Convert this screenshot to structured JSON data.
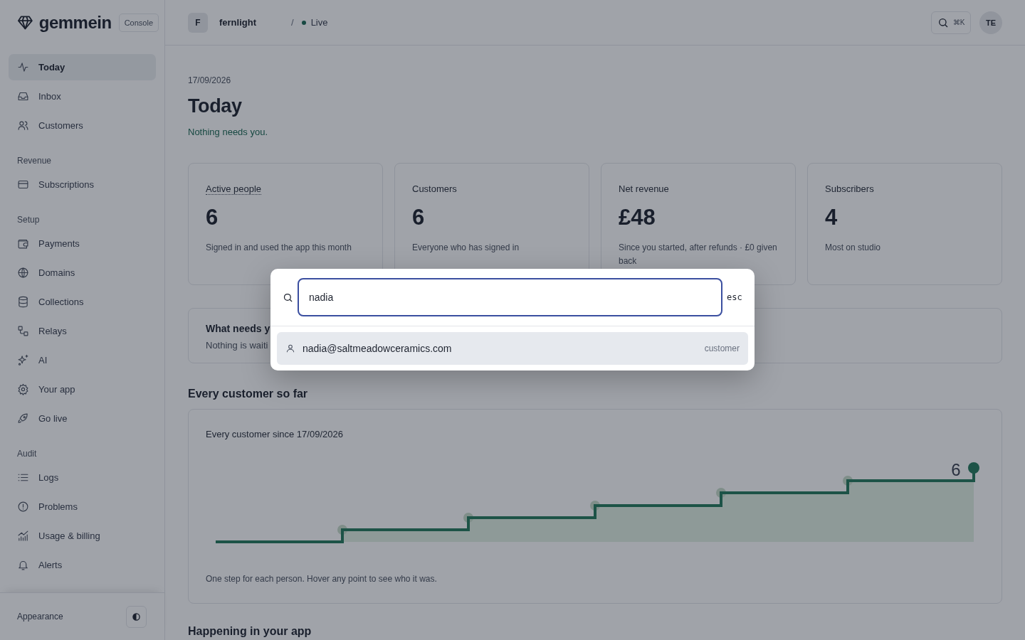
{
  "brand": {
    "name": "gemmein",
    "badge": "Console"
  },
  "nav": [
    {
      "items": [
        {
          "label": "Today",
          "selected": true
        },
        {
          "label": "Inbox",
          "selected": false
        },
        {
          "label": "Customers",
          "selected": false
        }
      ]
    },
    {
      "heading": "Revenue",
      "items": [
        {
          "label": "Subscriptions",
          "selected": false
        }
      ]
    },
    {
      "heading": "Setup",
      "items": [
        {
          "label": "Payments",
          "selected": false
        },
        {
          "label": "Domains",
          "selected": false
        },
        {
          "label": "Collections",
          "selected": false
        },
        {
          "label": "Relays",
          "selected": false
        },
        {
          "label": "AI",
          "selected": false
        },
        {
          "label": "Your app",
          "selected": false
        },
        {
          "label": "Go live",
          "selected": false
        }
      ]
    },
    {
      "heading": "Audit",
      "items": [
        {
          "label": "Logs",
          "selected": false
        },
        {
          "label": "Problems",
          "selected": false
        },
        {
          "label": "Usage & billing",
          "selected": false
        },
        {
          "label": "Alerts",
          "selected": false
        }
      ]
    }
  ],
  "appearance": {
    "label": "Appearance"
  },
  "topbar": {
    "project_initial": "F",
    "project": "fernlight",
    "separator": "/",
    "status": "Live",
    "search_shortcut": "⌘K",
    "avatar": "TE"
  },
  "page": {
    "date": "17/09/2026",
    "title": "Today",
    "message": "Nothing needs you."
  },
  "stats": [
    {
      "label": "Active people",
      "hint": true,
      "value": "6",
      "note": "Signed in and used the app this month"
    },
    {
      "label": "Customers",
      "hint": false,
      "value": "6",
      "note": "Everyone who has signed in"
    },
    {
      "label": "Net revenue",
      "hint": false,
      "value": "£48",
      "note": "Since you started, after refunds · £0 given back"
    },
    {
      "label": "Subscribers",
      "hint": false,
      "value": "4",
      "note": "Most on studio"
    }
  ],
  "attention": {
    "title": "What needs y",
    "text": "Nothing is waiti"
  },
  "growth": {
    "heading": "Every customer so far",
    "title": "Every customer since 17/09/2026",
    "end_label": "6",
    "footnote": "One step for each person. Hover any point to see who it was."
  },
  "next_heading": "Happening in your app",
  "palette": {
    "query": "nadia",
    "esc": "esc",
    "results": [
      {
        "text": "nadia@saltmeadowceramics.com",
        "type": "customer",
        "selected": true
      }
    ]
  }
}
